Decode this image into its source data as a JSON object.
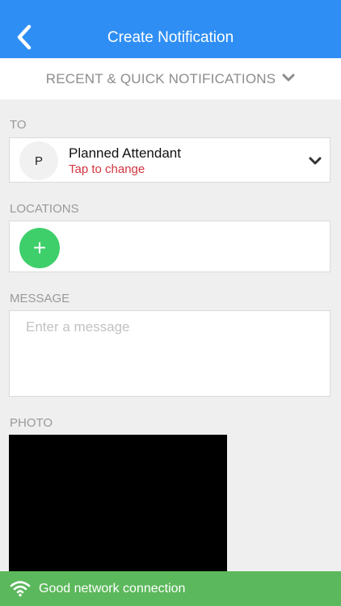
{
  "header": {
    "title": "Create Notification",
    "back_icon": "chevron-left-icon",
    "bg_color": "#2f8ef4"
  },
  "quick": {
    "label": "RECENT & QUICK NOTIFICATIONS",
    "icon": "chevron-down-icon"
  },
  "to": {
    "section_label": "TO",
    "avatar_initial": "P",
    "name": "Planned Attendant",
    "subtitle": "Tap to change",
    "subtitle_color": "#d0353f",
    "icon": "chevron-down-icon"
  },
  "locations": {
    "section_label": "LOCATIONS",
    "add_icon": "+",
    "add_color": "#3ecf6b"
  },
  "message": {
    "section_label": "MESSAGE",
    "placeholder": "Enter a message",
    "value": ""
  },
  "photo": {
    "section_label": "PHOTO"
  },
  "network": {
    "status": "Good network connection",
    "icon": "wifi-icon",
    "bg_color": "#5cb85c"
  }
}
